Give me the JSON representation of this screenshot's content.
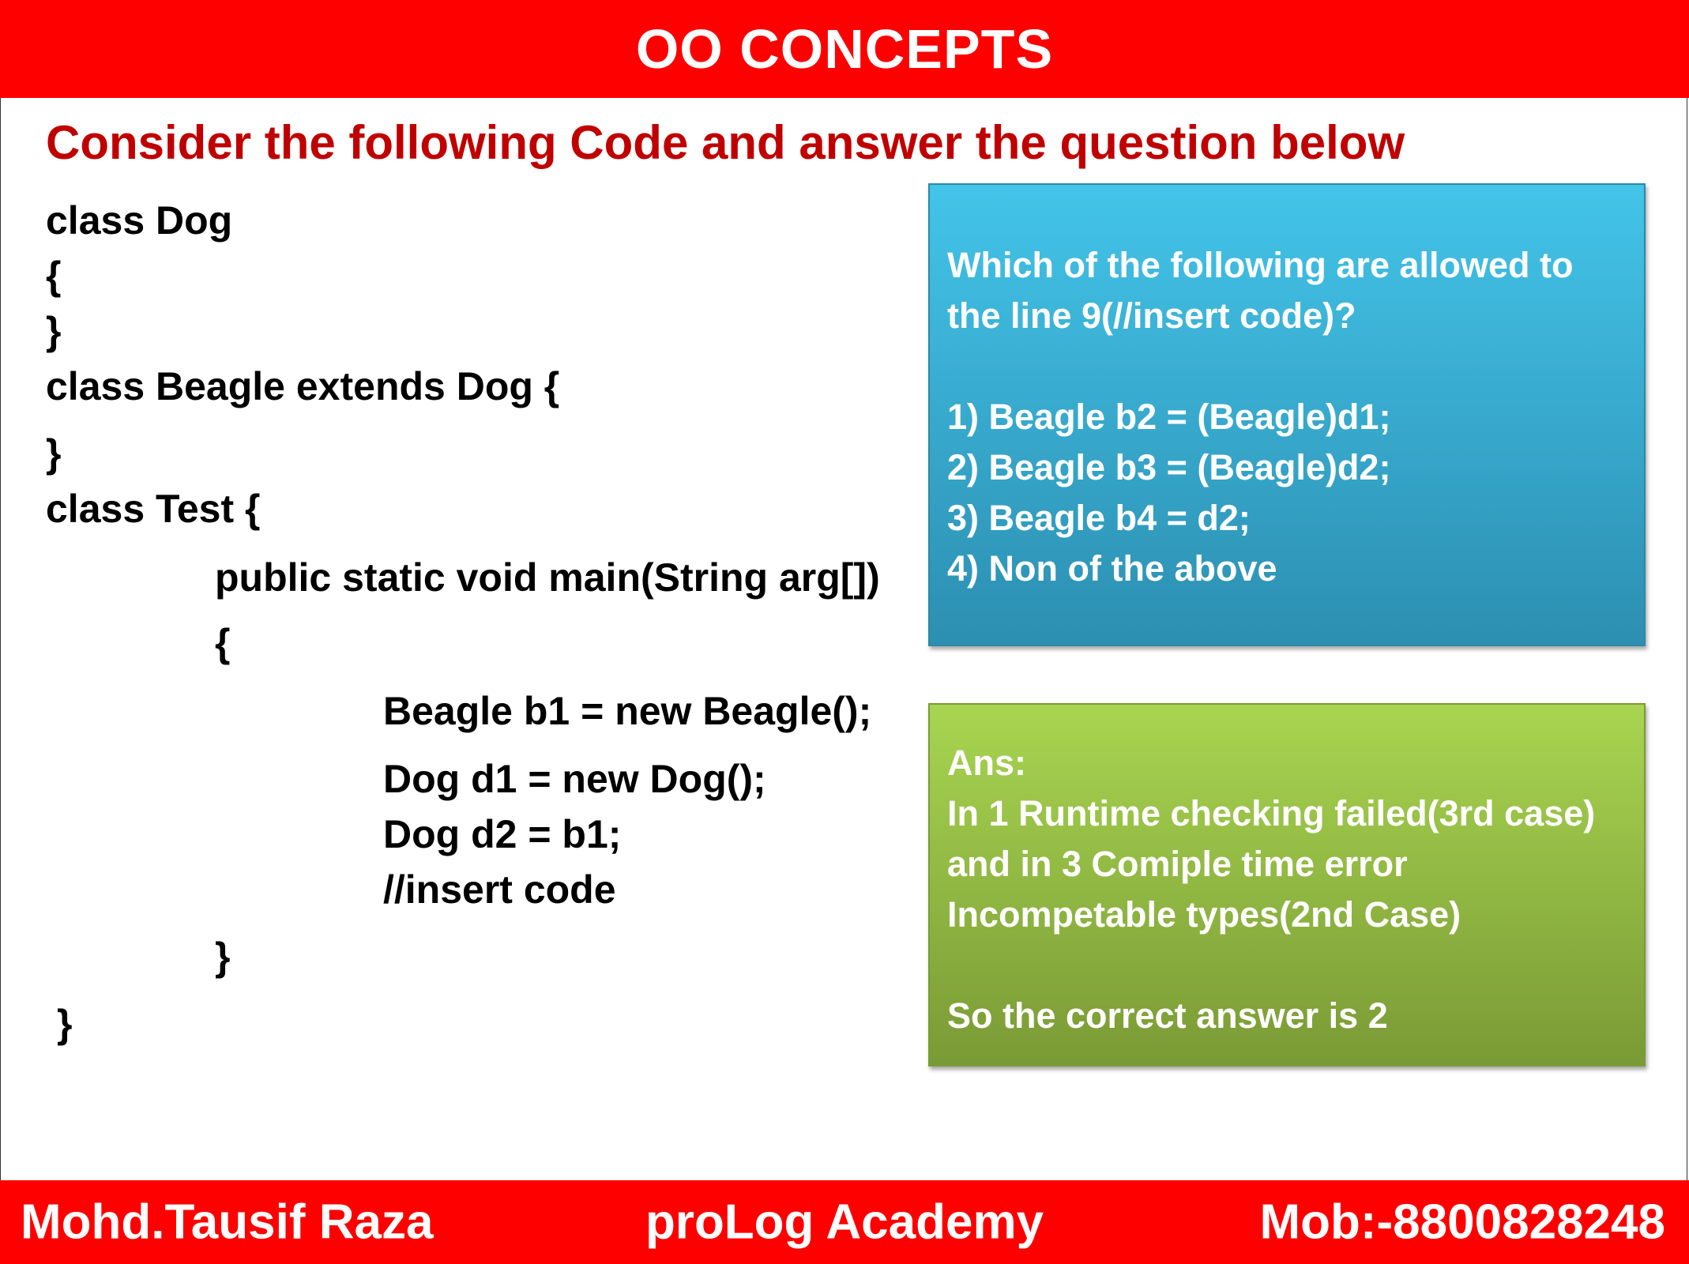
{
  "slide": {
    "title": "OO CONCEPTS",
    "heading": "Consider the following Code and answer the question below"
  },
  "code": [
    "class Dog",
    "{",
    "}",
    "class Beagle extends Dog {",
    "}",
    "class Test {",
    "public static void main(String arg[])",
    "{",
    "Beagle b1 = new Beagle();",
    "Dog d1 = new Dog();",
    "Dog d2 = b1;",
    "//insert code",
    "}",
    "}"
  ],
  "question": {
    "text_line1": "Which of the following are allowed to",
    "text_line2": "the line 9(//insert code)?",
    "options": [
      "1) Beagle b2 = (Beagle)d1;",
      "2) Beagle b3 = (Beagle)d2;",
      "3) Beagle b4 = d2;",
      "4) Non of the above"
    ]
  },
  "answer": {
    "label": "Ans:",
    "lines": [
      "In 1 Runtime checking failed(3rd case)",
      "and in 3 Comiple time error",
      "Incompetable types(2nd Case)"
    ],
    "conclusion": "So the correct answer is 2"
  },
  "footer": {
    "author": "Mohd.Tausif Raza",
    "academy": "proLog Academy",
    "phone": "Mob:-8800828248"
  },
  "colors": {
    "bar_red": "#fe0000",
    "heading_red": "#c00000",
    "question_blue": "#3bb8dc",
    "answer_green": "#92c047"
  }
}
